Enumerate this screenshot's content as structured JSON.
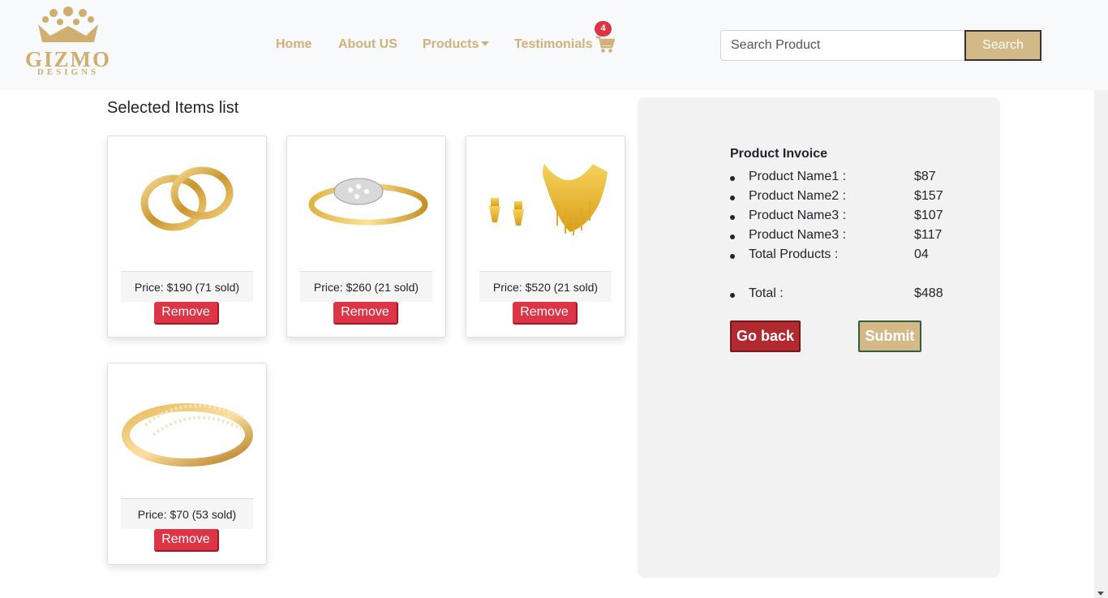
{
  "brand": {
    "logo_text": "GIZMO",
    "logo_sub": "DESIGNS",
    "gold": "#d2b07a"
  },
  "nav": {
    "home": "Home",
    "about": "About US",
    "products": "Products",
    "testimonials": "Testimonials",
    "cart_count": "4"
  },
  "search": {
    "placeholder": "Search Product",
    "value": "",
    "button": "Search"
  },
  "list": {
    "title": "Selected Items list",
    "items": [
      {
        "name": "gold-rings",
        "price_label": "Price: $190 (71 sold)",
        "remove_label": "Remove"
      },
      {
        "name": "diamond-ring",
        "price_label": "Price: $260 (21 sold)",
        "remove_label": "Remove"
      },
      {
        "name": "gold-necklace-set",
        "price_label": "Price: $520 (21 sold)",
        "remove_label": "Remove"
      },
      {
        "name": "twisted-gold-ring",
        "price_label": "Price: $70 (53 sold)",
        "remove_label": "Remove"
      }
    ]
  },
  "invoice": {
    "title": "Product Invoice",
    "rows": [
      {
        "label": "Product Name1 :",
        "value": "$87"
      },
      {
        "label": "Product Name2 :",
        "value": "$157"
      },
      {
        "label": "Product Name3 :",
        "value": "$107"
      },
      {
        "label": "Product Name3 :",
        "value": "$117"
      },
      {
        "label": "Total Products :",
        "value": "04"
      },
      {
        "label": "Total :",
        "value": "$488"
      }
    ],
    "go_back": "Go back",
    "submit": "Submit"
  },
  "colors": {
    "danger": "#dc3545",
    "accent": "#d4b886",
    "panel": "#f2f2f2"
  }
}
